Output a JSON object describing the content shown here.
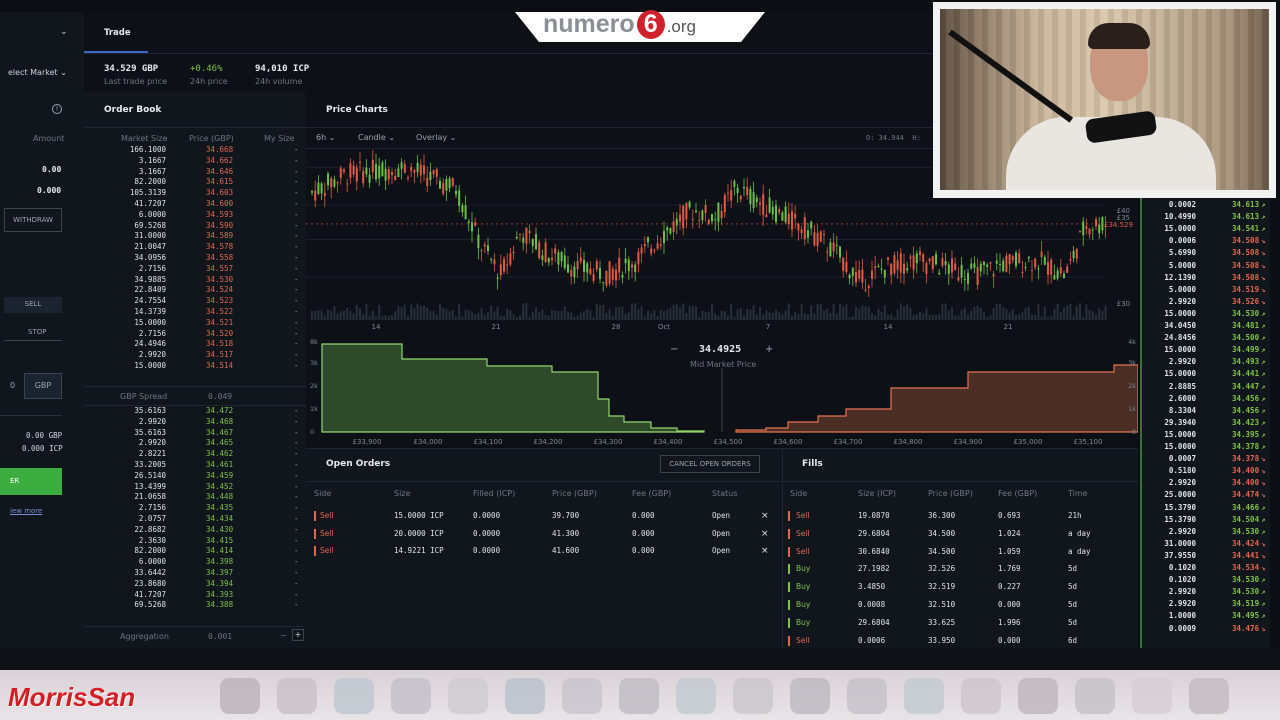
{
  "brand": {
    "top_logo_a": "numero",
    "top_logo_num": "6",
    "top_logo_b": ".org",
    "bottom_logo": "MorrisSan"
  },
  "topbar": {
    "tab": "Trade",
    "market_select": "elect Market"
  },
  "stats": [
    {
      "value": "34.529 GBP",
      "label": "Last trade price"
    },
    {
      "value": "+0.46%",
      "label": "24h price"
    },
    {
      "value": "94,010 ICP",
      "label": "24h volume"
    }
  ],
  "left": {
    "amount_label": "Amount",
    "amount1": "0.00",
    "amount2": "0.000",
    "withdraw": "WITHDRAW",
    "sell": "SELL",
    "stop": "STOP",
    "gbp": "GBP",
    "bal1": "0.00 GBP",
    "bal2": "0.000 ICP",
    "submit": "ER",
    "view_more": "iew more",
    "zero": "0"
  },
  "orderbook": {
    "title": "Order Book",
    "cols": [
      "Market Size",
      "Price (GBP)",
      "My Size"
    ],
    "asks": [
      [
        "166.1000",
        "34.668"
      ],
      [
        "3.1667",
        "34.662"
      ],
      [
        "3.1667",
        "34.646"
      ],
      [
        "82.2000",
        "34.615"
      ],
      [
        "105.3139",
        "34.603"
      ],
      [
        "41.7207",
        "34.600"
      ],
      [
        "6.0000",
        "34.593"
      ],
      [
        "69.5268",
        "34.590"
      ],
      [
        "31.0000",
        "34.589"
      ],
      [
        "21.0047",
        "34.578"
      ],
      [
        "34.0956",
        "34.558"
      ],
      [
        "2.7156",
        "34.557"
      ],
      [
        "34.9885",
        "34.530"
      ],
      [
        "22.8409",
        "34.524"
      ],
      [
        "24.7554",
        "34.523"
      ],
      [
        "14.3739",
        "34.522"
      ],
      [
        "15.0000",
        "34.521"
      ],
      [
        "2.7156",
        "34.520"
      ],
      [
        "24.4946",
        "34.518"
      ],
      [
        "2.9920",
        "34.517"
      ],
      [
        "15.0000",
        "34.514"
      ]
    ],
    "spread_label": "GBP Spread",
    "spread": "0.049",
    "bids": [
      [
        "35.6163",
        "34.472"
      ],
      [
        "2.9920",
        "34.468"
      ],
      [
        "35.6163",
        "34.467"
      ],
      [
        "2.9920",
        "34.465"
      ],
      [
        "2.8221",
        "34.462"
      ],
      [
        "33.2005",
        "34.461"
      ],
      [
        "26.5140",
        "34.459"
      ],
      [
        "13.4399",
        "34.452"
      ],
      [
        "21.0658",
        "34.448"
      ],
      [
        "2.7156",
        "34.435"
      ],
      [
        "2.0757",
        "34.434"
      ],
      [
        "22.8682",
        "34.430"
      ],
      [
        "2.3630",
        "34.415"
      ],
      [
        "82.2000",
        "34.414"
      ],
      [
        "6.0000",
        "34.398"
      ],
      [
        "33.6442",
        "34.397"
      ],
      [
        "23.8680",
        "34.394"
      ],
      [
        "41.7207",
        "34.393"
      ],
      [
        "69.5268",
        "34.388"
      ]
    ],
    "my_size": "-",
    "aggregation_label": "Aggregation",
    "aggregation": "0.001",
    "minus": "−",
    "plus": "+"
  },
  "chart": {
    "title": "Price Charts",
    "interval": "6h",
    "type": "Candle",
    "overlay": "Overlay",
    "readout": "O: 34.944  H:",
    "xticks": [
      "14",
      "21",
      "28",
      "Oct",
      "7",
      "14",
      "21"
    ],
    "yticks": [
      "£40",
      "£35",
      "£30"
    ],
    "last_price_tag": "£34.529"
  },
  "depth": {
    "mid_price": "34.4925",
    "mid_label": "Mid Market Price",
    "minus": "−",
    "plus": "+",
    "xticks": [
      "£33,900",
      "£34,000",
      "£34,100",
      "£34,200",
      "£34,300",
      "£34,400",
      "£34,500",
      "£34,600",
      "£34,700",
      "£34,800",
      "£34,900",
      "£35,000",
      "£35,100"
    ],
    "yticks_left": [
      "8k",
      "3k",
      "2k",
      "1k",
      "0"
    ],
    "yticks_right": [
      "4k",
      "3k",
      "2k",
      "1k",
      "0"
    ]
  },
  "open_orders": {
    "title": "Open Orders",
    "cancel": "CANCEL OPEN ORDERS",
    "cols": [
      "Side",
      "Size",
      "Filled (ICP)",
      "Price (GBP)",
      "Fee (GBP)",
      "Status"
    ],
    "rows": [
      [
        "Sell",
        "15.0000 ICP",
        "0.0000",
        "39.700",
        "0.000",
        "Open"
      ],
      [
        "Sell",
        "20.0000 ICP",
        "0.0000",
        "41.300",
        "0.000",
        "Open"
      ],
      [
        "Sell",
        "14.9221 ICP",
        "0.0000",
        "41.600",
        "0.000",
        "Open"
      ]
    ],
    "close": "×"
  },
  "fills": {
    "title": "Fills",
    "cols": [
      "Side",
      "Size (ICP)",
      "Price (GBP)",
      "Fee (GBP)",
      "Time"
    ],
    "rows": [
      [
        "Sell",
        "19.0870",
        "36.300",
        "0.693",
        "21h"
      ],
      [
        "Sell",
        "29.6804",
        "34.500",
        "1.024",
        "a day"
      ],
      [
        "Sell",
        "30.6840",
        "34.500",
        "1.059",
        "a day"
      ],
      [
        "Buy",
        "27.1982",
        "32.526",
        "1.769",
        "5d"
      ],
      [
        "Buy",
        "3.4850",
        "32.519",
        "0.227",
        "5d"
      ],
      [
        "Buy",
        "0.0008",
        "32.510",
        "0.000",
        "5d"
      ],
      [
        "Buy",
        "29.6804",
        "33.625",
        "1.996",
        "5d"
      ],
      [
        "Sell",
        "0.0006",
        "33.950",
        "0.000",
        "6d"
      ]
    ]
  },
  "trades": [
    [
      "0.0002",
      "34.613",
      "up"
    ],
    [
      "10.4990",
      "34.613",
      "up"
    ],
    [
      "15.0000",
      "34.541",
      "up"
    ],
    [
      "0.0006",
      "34.508",
      "down"
    ],
    [
      "5.6990",
      "34.508",
      "down"
    ],
    [
      "5.0000",
      "34.508",
      "down"
    ],
    [
      "12.1390",
      "34.508",
      "down"
    ],
    [
      "5.0000",
      "34.519",
      "down"
    ],
    [
      "2.9920",
      "34.526",
      "down"
    ],
    [
      "15.0000",
      "34.530",
      "up"
    ],
    [
      "34.0450",
      "34.481",
      "up"
    ],
    [
      "24.8456",
      "34.500",
      "up"
    ],
    [
      "15.0000",
      "34.499",
      "up"
    ],
    [
      "2.9920",
      "34.493",
      "up"
    ],
    [
      "15.0000",
      "34.441",
      "up"
    ],
    [
      "2.8885",
      "34.447",
      "up"
    ],
    [
      "2.6000",
      "34.456",
      "up"
    ],
    [
      "8.3304",
      "34.456",
      "up"
    ],
    [
      "29.3940",
      "34.423",
      "up"
    ],
    [
      "15.0000",
      "34.395",
      "up"
    ],
    [
      "15.0000",
      "34.378",
      "up"
    ],
    [
      "0.0007",
      "34.378",
      "down"
    ],
    [
      "0.5180",
      "34.400",
      "down"
    ],
    [
      "2.9920",
      "34.400",
      "down"
    ],
    [
      "25.0000",
      "34.474",
      "down"
    ],
    [
      "15.3790",
      "34.466",
      "up"
    ],
    [
      "15.3790",
      "34.504",
      "up"
    ],
    [
      "2.9920",
      "34.530",
      "up"
    ],
    [
      "31.0000",
      "34.424",
      "down"
    ],
    [
      "37.9550",
      "34.441",
      "down"
    ],
    [
      "0.1020",
      "34.534",
      "down"
    ],
    [
      "0.1020",
      "34.530",
      "up"
    ],
    [
      "2.9920",
      "34.530",
      "up"
    ],
    [
      "2.9920",
      "34.519",
      "up"
    ],
    [
      "1.0000",
      "34.495",
      "up"
    ],
    [
      "0.0009",
      "34.476",
      "down"
    ]
  ]
}
